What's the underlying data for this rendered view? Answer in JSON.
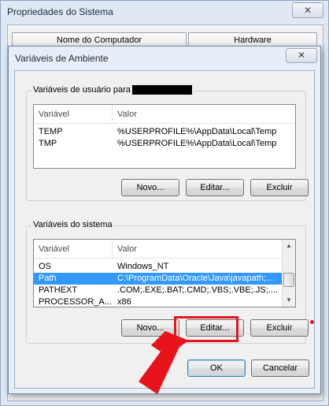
{
  "outer_window": {
    "title": "Propriedades do Sistema",
    "close_label": "✕",
    "tabs": [
      "Nome do Computador",
      "Hardware"
    ]
  },
  "dialog": {
    "title": "Variáveis de Ambiente",
    "close_label": "✕",
    "user_vars": {
      "group_label": "Variáveis de usuário para",
      "columns": [
        "Variável",
        "Valor"
      ],
      "rows": [
        {
          "name": "TEMP",
          "value": "%USERPROFILE%\\AppData\\Local\\Temp"
        },
        {
          "name": "TMP",
          "value": "%USERPROFILE%\\AppData\\Local\\Temp"
        }
      ],
      "buttons": {
        "new": "Novo...",
        "edit": "Editar...",
        "delete": "Excluir"
      }
    },
    "system_vars": {
      "group_label": "Variáveis do sistema",
      "columns": [
        "Variável",
        "Valor"
      ],
      "rows": [
        {
          "name": "OS",
          "value": "Windows_NT"
        },
        {
          "name": "Path",
          "value": "C:\\ProgramData\\Oracle\\Java\\javapath;..."
        },
        {
          "name": "PATHEXT",
          "value": ".COM;.EXE;.BAT;.CMD;.VBS;.VBE;.JS;...."
        },
        {
          "name": "PROCESSOR_A...",
          "value": "x86"
        }
      ],
      "selected_index": 1,
      "buttons": {
        "new": "Novo...",
        "edit": "Editar...",
        "delete": "Excluir"
      }
    },
    "ok_label": "OK",
    "cancel_label": "Cancelar"
  },
  "annotation": {
    "highlight_color": "#e8141c"
  }
}
